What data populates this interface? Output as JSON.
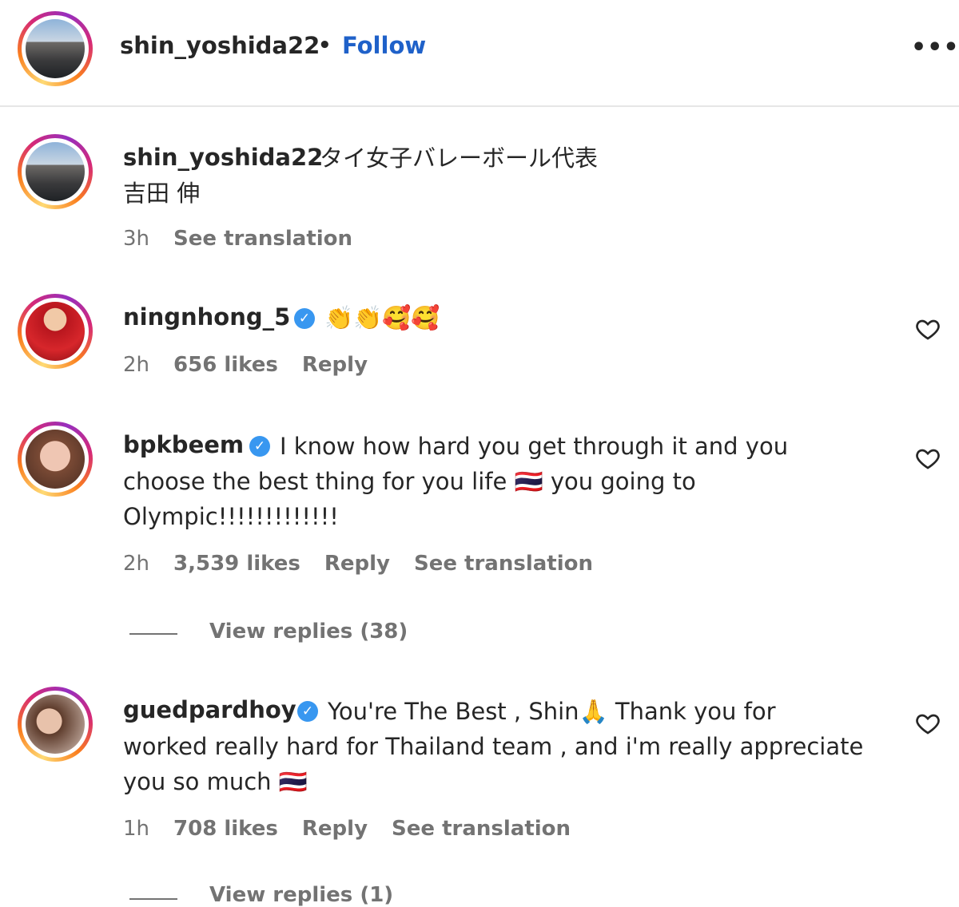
{
  "header": {
    "username": "shin_yoshida22",
    "separator": "•",
    "follow_label": "Follow",
    "more_label": "•••"
  },
  "caption": {
    "username": "shin_yoshida22",
    "line1": "タイ女子バレーボール代表",
    "line2": "吉田 伸",
    "time": "3h",
    "see_translation": "See translation"
  },
  "comments": [
    {
      "username": "ningnhong_5",
      "verified": true,
      "text": "👏👏🥰🥰",
      "time": "2h",
      "likes": "656 likes",
      "reply": "Reply"
    },
    {
      "username": "bpkbeem",
      "verified": true,
      "line1": "I know how hard you get through it and you",
      "line2": "choose the best thing for you life 🇹🇭 you going to",
      "line3": "Olympic!!!!!!!!!!!!!",
      "time": "2h",
      "likes": "3,539 likes",
      "reply": "Reply",
      "see_translation": "See translation",
      "view_replies": "View replies (38)"
    },
    {
      "username": "guedpardhoy",
      "verified": true,
      "line1": "You're The Best , Shin🙏 Thank you for",
      "line2": "worked really hard for Thailand team , and i'm really appreciate",
      "line3": "you so much 🇹🇭",
      "time": "1h",
      "likes": "708 likes",
      "reply": "Reply",
      "see_translation": "See translation",
      "view_replies": "View replies (1)"
    }
  ],
  "icons": {
    "verified": "verified-badge-icon",
    "heart": "heart-outline-icon",
    "more": "more-horizontal-icon"
  },
  "colors": {
    "follow": "#1f61c9",
    "verified": "#3897f0",
    "muted": "#737373"
  }
}
